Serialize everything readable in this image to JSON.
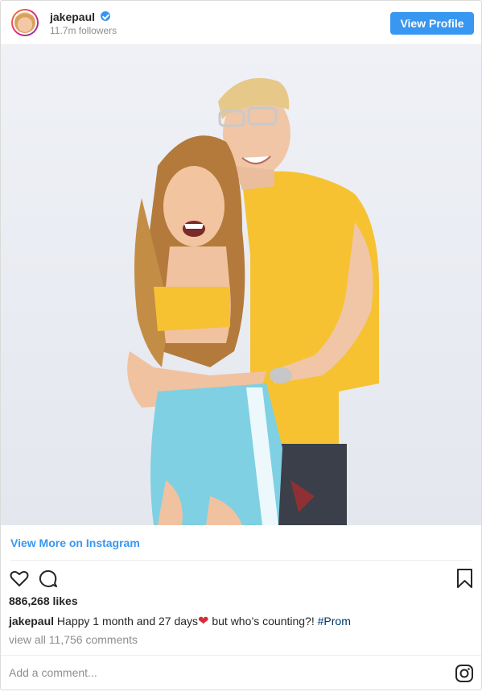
{
  "header": {
    "username": "jakepaul",
    "followers": "11.7m followers",
    "view_profile_label": "View Profile"
  },
  "post": {
    "view_more_label": "View More on Instagram",
    "likes": "886,268 likes",
    "caption": {
      "username": "jakepaul",
      "text_before_emoji": "Happy 1 month and 27 days",
      "emoji": "❤",
      "text_after_emoji": " but who’s counting?! ",
      "hashtag": "#Prom"
    },
    "view_comments_label": "view all 11,756 comments",
    "add_comment_placeholder": "Add a comment..."
  },
  "colors": {
    "accent": "#3897f0",
    "verified": "#3897f0",
    "hashtag": "#003569",
    "muted": "#8e8e8e"
  },
  "icons": [
    "verified-badge-icon",
    "heart-icon",
    "comment-icon",
    "bookmark-icon",
    "instagram-logo-icon"
  ]
}
